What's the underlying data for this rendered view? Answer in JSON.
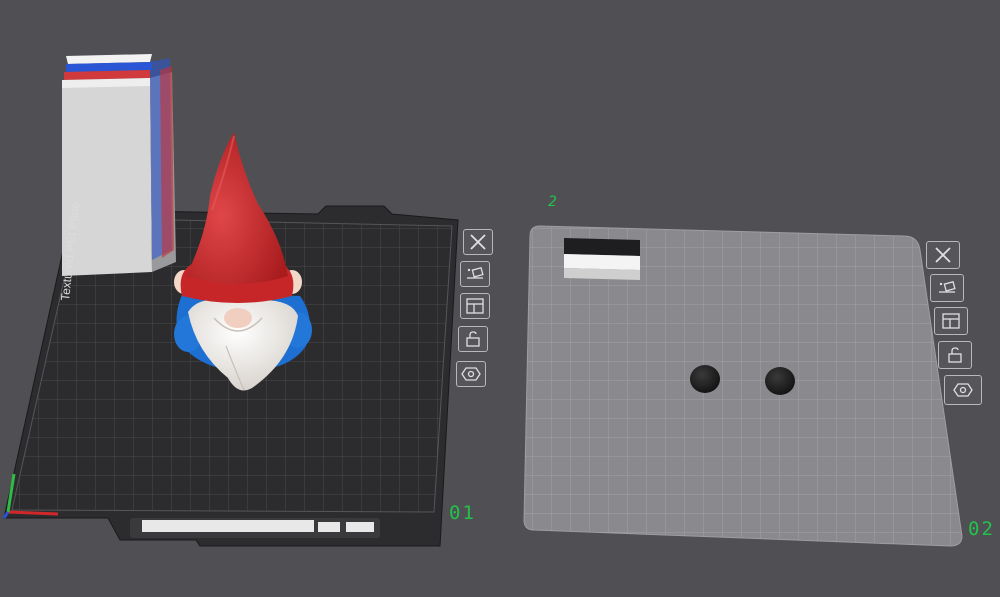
{
  "plates": [
    {
      "id": "plate-1",
      "index_label": "01",
      "bed_name": "Textured PEI Plate",
      "bottom_text": "",
      "tools": [
        {
          "name": "remove-plate",
          "icon": "close-icon"
        },
        {
          "name": "auto-arrange",
          "icon": "auto-orient-icon"
        },
        {
          "name": "arrange",
          "icon": "layout-icon"
        },
        {
          "name": "lock-plate",
          "icon": "lock-icon"
        },
        {
          "name": "plate-settings",
          "icon": "gear-hex-icon"
        }
      ],
      "objects": [
        "gnome-model",
        "prime-tower"
      ]
    },
    {
      "id": "plate-2",
      "index_label": "02",
      "name_tag": "2",
      "tools": [
        {
          "name": "remove-plate",
          "icon": "close-icon"
        },
        {
          "name": "auto-arrange",
          "icon": "auto-orient-icon"
        },
        {
          "name": "arrange",
          "icon": "layout-icon"
        },
        {
          "name": "lock-plate",
          "icon": "lock-icon"
        },
        {
          "name": "plate-settings",
          "icon": "gear-hex-icon"
        }
      ],
      "objects": [
        "eye-left",
        "eye-right",
        "prime-tower"
      ]
    }
  ],
  "colors": {
    "background": "#505054",
    "bed_dark": "#2c2c2e",
    "bed_light": "#8a8a8e",
    "label_green": "#22c24a",
    "hat_red": "#cf2a2c",
    "body_blue": "#1d6fd1",
    "beard_white": "#ece8e2",
    "eye_black": "#1c1c1c"
  }
}
